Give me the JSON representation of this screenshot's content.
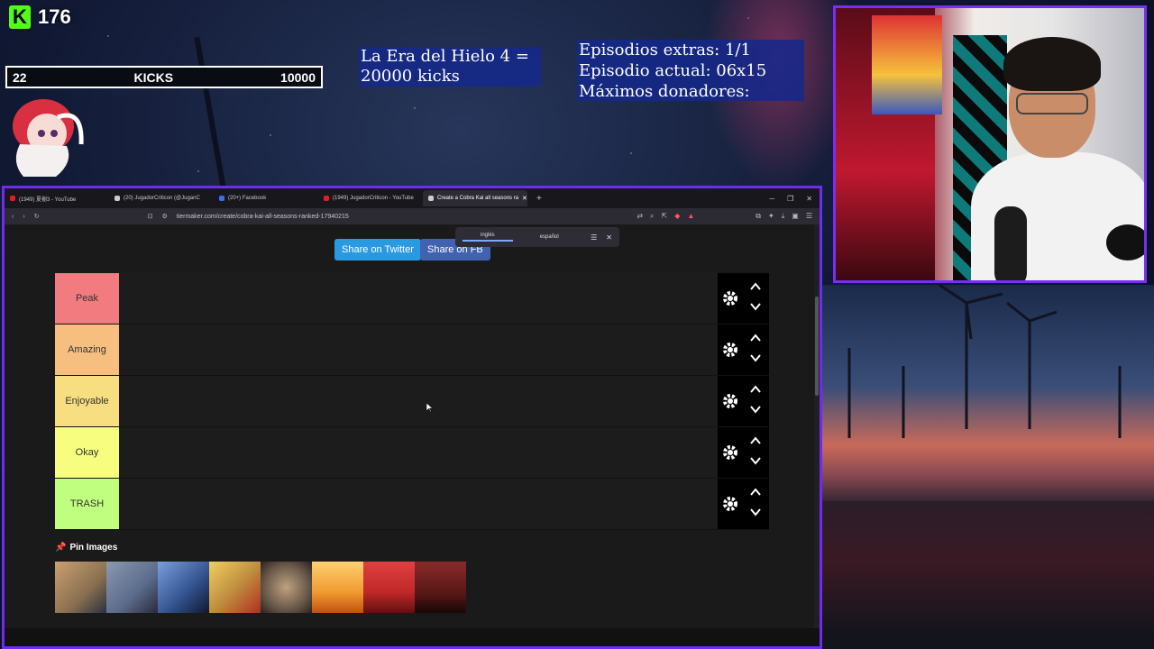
{
  "kick": {
    "counter": "176",
    "goal_current": "22",
    "goal_label": "KICKS",
    "goal_target": "10000"
  },
  "overlay": {
    "era_line1": "La Era del Hielo 4 =",
    "era_line2": "20000 kicks",
    "info_line1": "Episodios extras: 1/1",
    "info_line2": "Episodio actual: 06x15",
    "info_line3": "Máximos donadores:"
  },
  "browser": {
    "tabs": [
      {
        "label": "(1949) 夏樹3 - YouTube",
        "color": "#e02020",
        "active": false
      },
      {
        "label": "(20) JugadorCriticon (@JuganC",
        "color": "#cccccc",
        "active": false
      },
      {
        "label": "(20+) Facebook",
        "color": "#3b6ee8",
        "active": false
      },
      {
        "label": "(1949) JugadorCriticon - YouTube",
        "color": "#e02020",
        "active": false
      },
      {
        "label": "Create a Cobra Kai all seasons ra",
        "color": "#cccccc",
        "active": true
      }
    ],
    "url": "tiermaker.com/create/cobra-kai-all-seasons-ranked-17940215",
    "translate": {
      "lang_active": "inglés",
      "lang_other": "español"
    }
  },
  "tiermaker": {
    "share_twitter": "Share on Twitter",
    "share_fb": "Share on FB",
    "tiers": [
      {
        "label": "Peak",
        "color": "#f27b7f"
      },
      {
        "label": "Amazing",
        "color": "#f6bf80"
      },
      {
        "label": "Enjoyable",
        "color": "#f7de80"
      },
      {
        "label": "Okay",
        "color": "#f7fe7f"
      },
      {
        "label": "TRASH",
        "color": "#c0fe7f"
      }
    ],
    "pin_title": "Pin Images",
    "posters": [
      "#8a7050",
      "#5a6a8a",
      "#30508a",
      "#c09040",
      "#6a5a4a",
      "#f09a30",
      "#c02828",
      "#5a1818"
    ]
  }
}
